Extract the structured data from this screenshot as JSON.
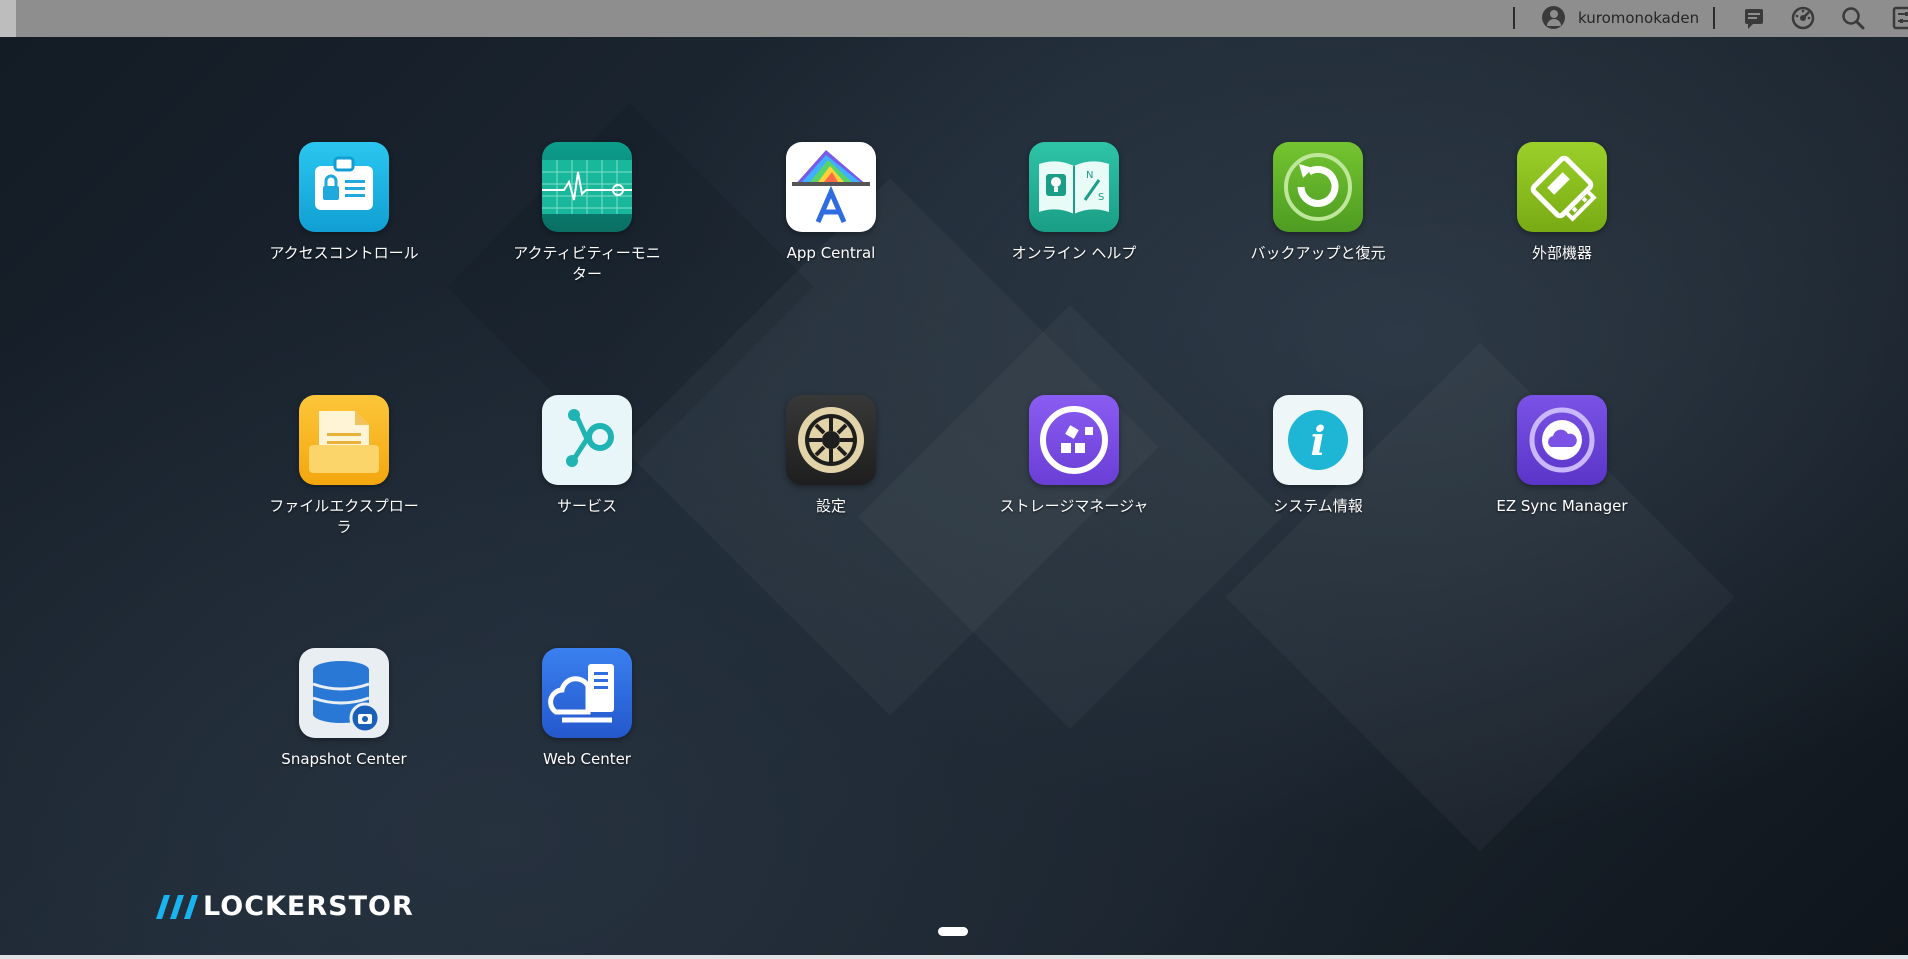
{
  "topbar": {
    "username": "kuromonokaden",
    "icons": [
      "user-icon",
      "message-icon",
      "dashboard-icon",
      "search-icon",
      "widget-settings-icon"
    ]
  },
  "apps": [
    {
      "label": "アクセスコントロール",
      "icon": "access-control-icon",
      "color": "#1fb8e6"
    },
    {
      "label": "アクティビティーモニター",
      "icon": "activity-monitor-icon",
      "color": "#0b8a7a"
    },
    {
      "label": "App Central",
      "icon": "app-central-icon",
      "color": "#ffffff"
    },
    {
      "label": "オンライン ヘルプ",
      "icon": "online-help-icon",
      "color": "#22b59a"
    },
    {
      "label": "バックアップと復元",
      "icon": "backup-restore-icon",
      "color": "#5ab02f"
    },
    {
      "label": "外部機器",
      "icon": "external-devices-icon",
      "color": "#8bc21d"
    },
    {
      "label": "ファイルエクスプローラ",
      "icon": "file-explorer-icon",
      "color": "#f7b41a"
    },
    {
      "label": "サービス",
      "icon": "services-icon",
      "color": "#e6f4f7"
    },
    {
      "label": "設定",
      "icon": "settings-gear-icon",
      "color": "#2a2a2a"
    },
    {
      "label": "ストレージマネージャ",
      "icon": "storage-manager-icon",
      "color": "#7b4fe6"
    },
    {
      "label": "システム情報",
      "icon": "system-information-icon",
      "color": "#eef6f8"
    },
    {
      "label": "EZ Sync Manager",
      "icon": "ez-sync-manager-icon",
      "color": "#6a44d8"
    },
    {
      "label": "Snapshot Center",
      "icon": "snapshot-center-icon",
      "color": "#e9eef2"
    },
    {
      "label": "Web Center",
      "icon": "web-center-icon",
      "color": "#2f6fe0"
    }
  ],
  "brand": {
    "name": "LOCKERSTOR"
  },
  "pager": {
    "current": 1,
    "total": 1
  }
}
